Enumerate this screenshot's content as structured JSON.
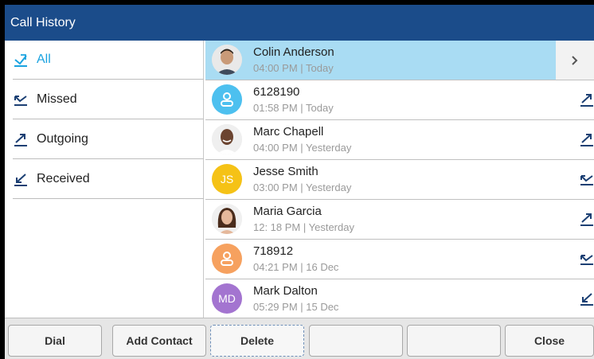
{
  "header": {
    "title": "Call History"
  },
  "sidebar": {
    "items": [
      {
        "label": "All",
        "icon": "all-calls-icon",
        "active": true
      },
      {
        "label": "Missed",
        "icon": "missed-call-icon",
        "active": false
      },
      {
        "label": "Outgoing",
        "icon": "outgoing-call-icon",
        "active": false
      },
      {
        "label": "Received",
        "icon": "received-call-icon",
        "active": false
      }
    ]
  },
  "calls": [
    {
      "name": "Colin Anderson",
      "time": "04:00 PM | Today",
      "avatar": "photo",
      "type": "selected",
      "selected": true
    },
    {
      "name": "6128190",
      "time": "01:58 PM | Today",
      "avatar": "generic",
      "avatar_color": "#4dc0ef",
      "type": "outgoing"
    },
    {
      "name": "Marc Chapell",
      "time": "04:00 PM | Yesterday",
      "avatar": "photo",
      "type": "outgoing"
    },
    {
      "name": "Jesse Smith",
      "time": "03:00 PM | Yesterday",
      "avatar": "initials",
      "initials": "JS",
      "avatar_color": "#f5c216",
      "type": "missed"
    },
    {
      "name": "Maria Garcia",
      "time": "12: 18 PM | Yesterday",
      "avatar": "photo",
      "type": "outgoing"
    },
    {
      "name": "718912",
      "time": "04:21 PM | 16 Dec",
      "avatar": "generic",
      "avatar_color": "#f6a15f",
      "type": "missed"
    },
    {
      "name": "Mark Dalton",
      "time": "05:29 PM | 15 Dec",
      "avatar": "initials",
      "initials": "MD",
      "avatar_color": "#a374d0",
      "type": "received"
    }
  ],
  "softkeys": [
    {
      "label": "Dial"
    },
    {
      "label": "Add Contact"
    },
    {
      "label": "Delete",
      "focused": true
    },
    {
      "label": ""
    },
    {
      "label": ""
    },
    {
      "label": "Close"
    }
  ],
  "colors": {
    "header": "#1b4c8a",
    "accent": "#1aa3e0",
    "selected_row": "#a9dcf3"
  }
}
